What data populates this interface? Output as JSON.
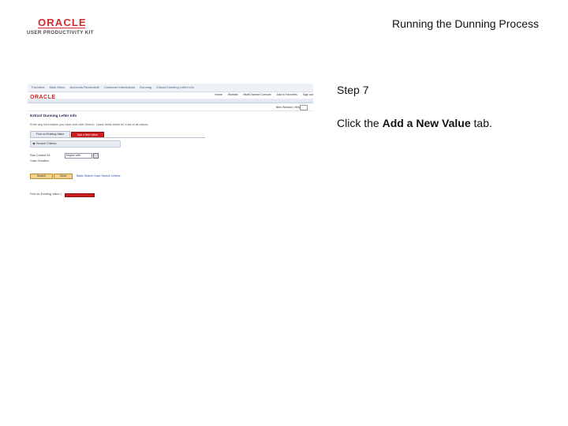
{
  "header": {
    "logo_text": "ORACLE",
    "logo_subtext": "USER PRODUCTIVITY KIT",
    "title": "Running the Dunning Process"
  },
  "screenshot": {
    "nav": [
      "Favorites",
      "Main Menu",
      "Accounts Receivable",
      "Customer Interactions",
      "Dunning",
      "Extract Dunning Letter Info"
    ],
    "logo_text": "ORACLE",
    "top_menu": [
      "Home",
      "Worklist",
      "MultiChannel Console",
      "Add to Favorites",
      "Sign out"
    ],
    "links": "New Window | Help",
    "page_title": "Extract Dunning Letter Info",
    "instruction": "Enter any information you have and click Search. Leave fields blank for a list of all values.",
    "tab_find": "Find an Existing Value",
    "tab_add": "Add a New Value",
    "criteria_label": "Search Criteria",
    "field_label": "Run Control ID:",
    "field_op": "begins with",
    "case_sensitive": "Case Sensitive",
    "btn_search": "Search",
    "btn_clear": "Clear",
    "basic_search": "Basic Search  Save Search Criteria",
    "find_label": "Find an Existing Value |"
  },
  "instructions": {
    "step": "Step 7",
    "text_prefix": "Click the ",
    "text_bold": "Add a New Value",
    "text_suffix": " tab."
  },
  "colors": {
    "oracle_red": "#d22d2d",
    "tab_highlight": "#cc1f1f"
  }
}
